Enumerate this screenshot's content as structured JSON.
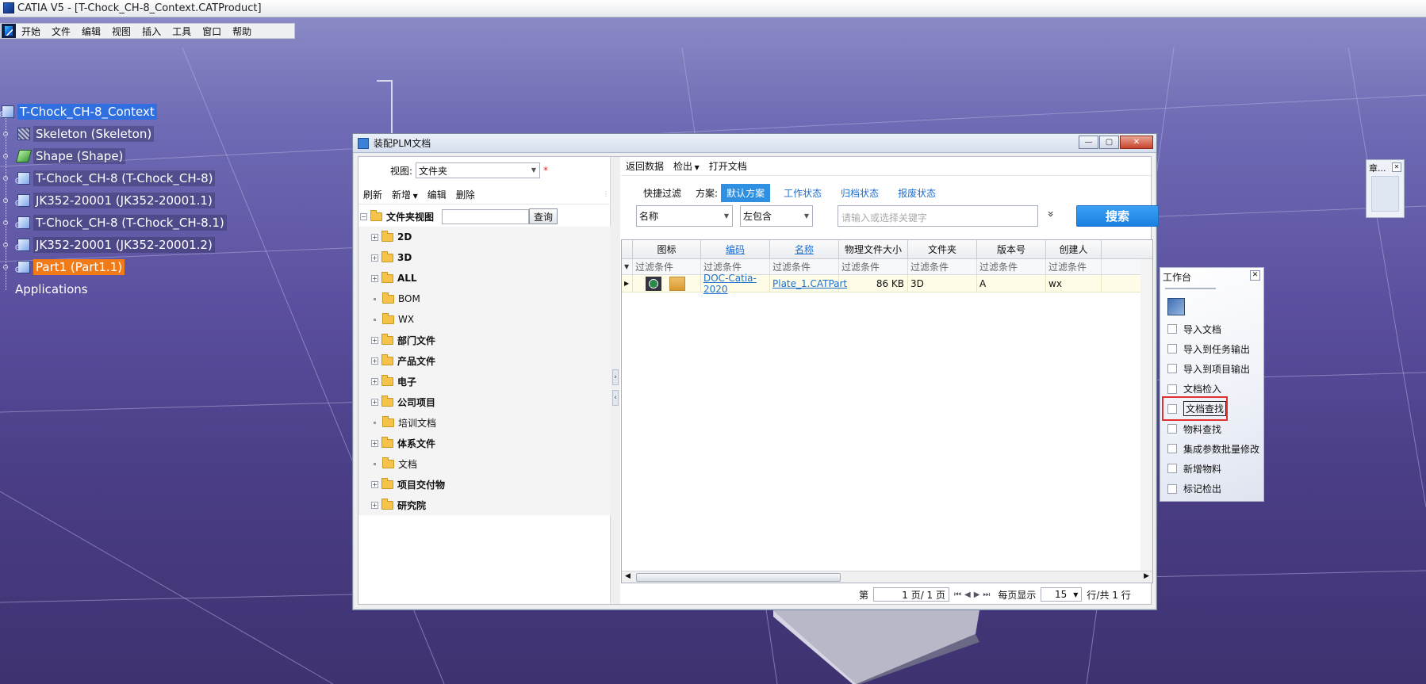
{
  "window": {
    "title": "CATIA V5 - [T-Chock_CH-8_Context.CATProduct]"
  },
  "menu": [
    "开始",
    "文件",
    "编辑",
    "视图",
    "插入",
    "工具",
    "窗口",
    "帮助"
  ],
  "spec_tree": {
    "root": "T-Chock_CH-8_Context",
    "children": [
      "Skeleton (Skeleton)",
      "Shape (Shape)",
      "T-Chock_CH-8 (T-Chock_CH-8)",
      "JK352-20001 (JK352-20001.1)",
      "T-Chock_CH-8 (T-Chock_CH-8.1)",
      "JK352-20001 (JK352-20001.2)",
      "Part1 (Part1.1)"
    ],
    "applications": "Applications"
  },
  "dialog": {
    "title": "装配PLM文档",
    "view_label": "视图:",
    "view_value": "文件夹",
    "required_mark": "*",
    "left_toolbar": {
      "refresh": "刷新",
      "new": "新增",
      "edit": "编辑",
      "delete": "删除"
    },
    "folder_tree": {
      "root": "文件夹视图",
      "query_button": "查询",
      "items": [
        {
          "label": "2D",
          "bold": true,
          "expandable": true
        },
        {
          "label": "3D",
          "bold": true,
          "expandable": true
        },
        {
          "label": "ALL",
          "bold": true,
          "expandable": true
        },
        {
          "label": "BOM",
          "bold": false,
          "expandable": false
        },
        {
          "label": "WX",
          "bold": false,
          "expandable": false
        },
        {
          "label": "部门文件",
          "bold": true,
          "expandable": true
        },
        {
          "label": "产品文件",
          "bold": true,
          "expandable": true
        },
        {
          "label": "电子",
          "bold": true,
          "expandable": true
        },
        {
          "label": "公司项目",
          "bold": true,
          "expandable": true
        },
        {
          "label": "培训文档",
          "bold": false,
          "expandable": false
        },
        {
          "label": "体系文件",
          "bold": true,
          "expandable": true
        },
        {
          "label": "文档",
          "bold": false,
          "expandable": false
        },
        {
          "label": "项目交付物",
          "bold": true,
          "expandable": true
        },
        {
          "label": "研究院",
          "bold": true,
          "expandable": true
        }
      ]
    },
    "right_toolbar": {
      "return_data": "返回数据",
      "checkout": "检出",
      "open_doc": "打开文档"
    },
    "quick_filter": {
      "label": "快捷过滤",
      "scheme_label": "方案:",
      "schemes": [
        "默认方案",
        "工作状态",
        "归档状态",
        "报废状态"
      ],
      "active_scheme": "默认方案"
    },
    "search": {
      "field": "名称",
      "operator": "左包含",
      "keyword_placeholder": "请输入或选择关键字",
      "expand_icon": "»",
      "button": "搜索"
    },
    "table": {
      "columns": [
        "图标",
        "编码",
        "名称",
        "物理文件大小",
        "文件夹",
        "版本号",
        "创建人"
      ],
      "filter_text": "过滤条件",
      "rows": [
        {
          "code": "DOC-Catia-2020",
          "name": "Plate_1.CATPart",
          "size": "86 KB",
          "folder": "3D",
          "version": "A",
          "creator": "wx"
        }
      ]
    },
    "pager": {
      "page_label": "第",
      "page_value": "1 页/ 1 页",
      "per_page_label": "每页显示",
      "per_page_value": "15",
      "total": "行/共 1 行"
    }
  },
  "workbench": {
    "title": "工作台",
    "items": [
      "导入文档",
      "导入到任务输出",
      "导入到项目输出",
      "文档检入",
      "文档查找",
      "物料查找",
      "集成参数批量修改",
      "新增物料",
      "标记检出"
    ],
    "highlighted": "文档查找"
  },
  "mini_panel": {
    "title": "章..."
  },
  "colors": {
    "selected_blue": "#2f6fe0",
    "selected_orange": "#f07b18",
    "active_scheme": "#2f8fe0",
    "search_button": "#1c7fe0",
    "highlight_box": "#e03030"
  }
}
